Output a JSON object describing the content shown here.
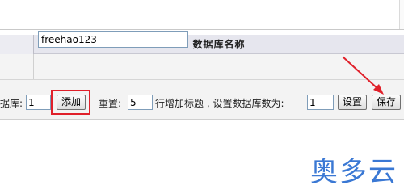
{
  "table": {
    "column_header": "数据库名称",
    "row_value": "freehao123"
  },
  "toolbar": {
    "add_prefix": "据库:",
    "add_count": "1",
    "add_button": "添加",
    "reset_label": "重置:",
    "reset_count": "5",
    "reset_suffix": "行增加标题 , 设置数据库数为:",
    "db_count": "1",
    "set_button": "设置",
    "save_button": "保存"
  },
  "watermark": "奥多云",
  "colors": {
    "highlight": "#e0202a",
    "watermark": "#3a78d4"
  }
}
